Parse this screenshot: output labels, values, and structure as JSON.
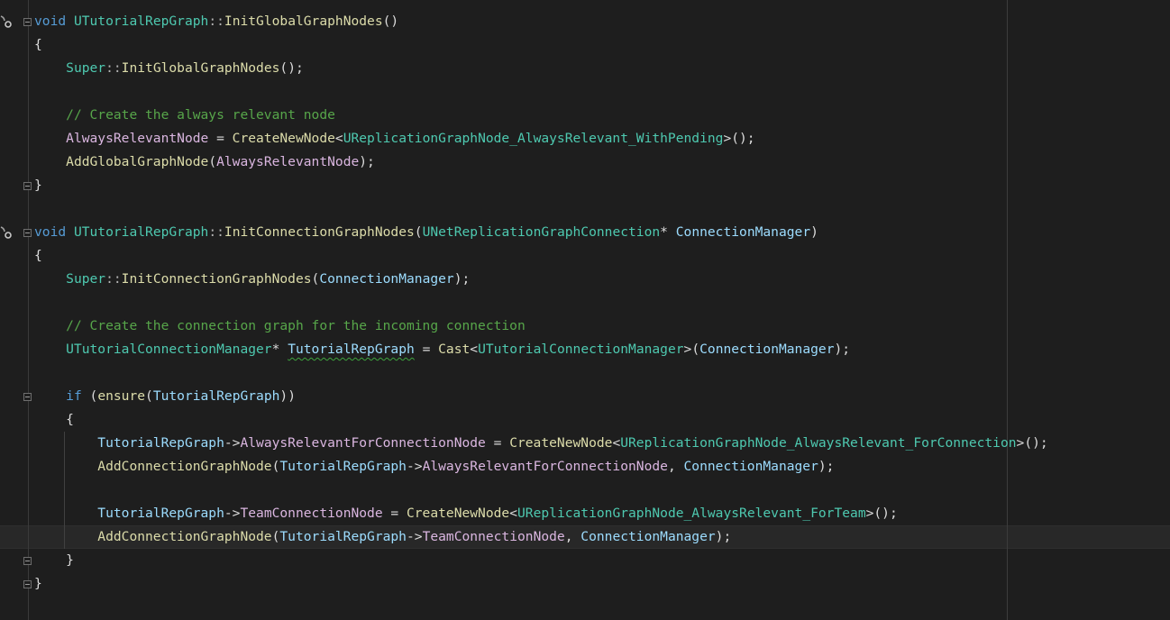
{
  "editor": {
    "lines": [
      {
        "tokens": [
          [
            "void",
            "kw"
          ],
          [
            " ",
            "default"
          ],
          [
            "UTutorialRepGraph",
            "type"
          ],
          [
            "::",
            "punct"
          ],
          [
            "InitGlobalGraphNodes",
            "fn"
          ],
          [
            "()",
            "default"
          ]
        ],
        "fold": true,
        "marker": true
      },
      {
        "tokens": [
          [
            "{",
            "default"
          ]
        ]
      },
      {
        "tokens": [
          [
            "    ",
            "default"
          ],
          [
            "Super",
            "type"
          ],
          [
            "::",
            "punct"
          ],
          [
            "InitGlobalGraphNodes",
            "fn"
          ],
          [
            "();",
            "default"
          ]
        ]
      },
      {
        "tokens": []
      },
      {
        "tokens": [
          [
            "    ",
            "default"
          ],
          [
            "// Create the always relevant node",
            "comment"
          ]
        ]
      },
      {
        "tokens": [
          [
            "    ",
            "default"
          ],
          [
            "AlwaysRelevantNode",
            "member"
          ],
          [
            " = ",
            "default"
          ],
          [
            "CreateNewNode",
            "fn"
          ],
          [
            "<",
            "default"
          ],
          [
            "UReplicationGraphNode_AlwaysRelevant_WithPending",
            "type"
          ],
          [
            ">();",
            "default"
          ]
        ]
      },
      {
        "tokens": [
          [
            "    ",
            "default"
          ],
          [
            "AddGlobalGraphNode",
            "fn"
          ],
          [
            "(",
            "default"
          ],
          [
            "AlwaysRelevantNode",
            "member"
          ],
          [
            ");",
            "default"
          ]
        ]
      },
      {
        "tokens": [
          [
            "}",
            "default"
          ]
        ],
        "fold": true
      },
      {
        "tokens": []
      },
      {
        "tokens": [
          [
            "void",
            "kw"
          ],
          [
            " ",
            "default"
          ],
          [
            "UTutorialRepGraph",
            "type"
          ],
          [
            "::",
            "punct"
          ],
          [
            "InitConnectionGraphNodes",
            "fn"
          ],
          [
            "(",
            "default"
          ],
          [
            "UNetReplicationGraphConnection",
            "type"
          ],
          [
            "* ",
            "default"
          ],
          [
            "ConnectionManager",
            "param"
          ],
          [
            ")",
            "default"
          ]
        ],
        "fold": true,
        "marker": true
      },
      {
        "tokens": [
          [
            "{",
            "default"
          ]
        ]
      },
      {
        "tokens": [
          [
            "    ",
            "default"
          ],
          [
            "Super",
            "type"
          ],
          [
            "::",
            "punct"
          ],
          [
            "InitConnectionGraphNodes",
            "fn"
          ],
          [
            "(",
            "default"
          ],
          [
            "ConnectionManager",
            "param"
          ],
          [
            ");",
            "default"
          ]
        ]
      },
      {
        "tokens": []
      },
      {
        "tokens": [
          [
            "    ",
            "default"
          ],
          [
            "// Create the connection graph for the incoming connection",
            "comment"
          ]
        ]
      },
      {
        "tokens": [
          [
            "    ",
            "default"
          ],
          [
            "UTutorialConnectionManager",
            "type"
          ],
          [
            "* ",
            "default"
          ],
          [
            "TutorialRepGraph",
            "local",
            "squiggle"
          ],
          [
            " = ",
            "default"
          ],
          [
            "Cast",
            "fn"
          ],
          [
            "<",
            "default"
          ],
          [
            "UTutorialConnectionManager",
            "type"
          ],
          [
            ">(",
            "default"
          ],
          [
            "ConnectionManager",
            "param"
          ],
          [
            ");",
            "default"
          ]
        ]
      },
      {
        "tokens": []
      },
      {
        "tokens": [
          [
            "    ",
            "default"
          ],
          [
            "if",
            "kw"
          ],
          [
            " (",
            "default"
          ],
          [
            "ensure",
            "fn"
          ],
          [
            "(",
            "default"
          ],
          [
            "TutorialRepGraph",
            "local"
          ],
          [
            "))",
            "default"
          ]
        ],
        "fold": true
      },
      {
        "tokens": [
          [
            "    {",
            "default"
          ]
        ]
      },
      {
        "tokens": [
          [
            "        ",
            "default"
          ],
          [
            "TutorialRepGraph",
            "local"
          ],
          [
            "->",
            "default"
          ],
          [
            "AlwaysRelevantForConnectionNode",
            "member"
          ],
          [
            " = ",
            "default"
          ],
          [
            "CreateNewNode",
            "fn"
          ],
          [
            "<",
            "default"
          ],
          [
            "UReplicationGraphNode_AlwaysRelevant_ForConnection",
            "type"
          ],
          [
            ">();",
            "default"
          ]
        ]
      },
      {
        "tokens": [
          [
            "        ",
            "default"
          ],
          [
            "AddConnectionGraphNode",
            "fn"
          ],
          [
            "(",
            "default"
          ],
          [
            "TutorialRepGraph",
            "local"
          ],
          [
            "->",
            "default"
          ],
          [
            "AlwaysRelevantForConnectionNode",
            "member"
          ],
          [
            ", ",
            "default"
          ],
          [
            "ConnectionManager",
            "param"
          ],
          [
            ");",
            "default"
          ]
        ]
      },
      {
        "tokens": []
      },
      {
        "tokens": [
          [
            "        ",
            "default"
          ],
          [
            "TutorialRepGraph",
            "local"
          ],
          [
            "->",
            "default"
          ],
          [
            "TeamConnectionNode",
            "member"
          ],
          [
            " = ",
            "default"
          ],
          [
            "CreateNewNode",
            "fn"
          ],
          [
            "<",
            "default"
          ],
          [
            "UReplicationGraphNode_AlwaysRelevant_ForTeam",
            "type"
          ],
          [
            ">();",
            "default"
          ]
        ]
      },
      {
        "tokens": [
          [
            "        ",
            "default"
          ],
          [
            "AddConnectionGraphNode",
            "fn"
          ],
          [
            "(",
            "default"
          ],
          [
            "TutorialRepGraph",
            "local"
          ],
          [
            "->",
            "default"
          ],
          [
            "TeamConnectionNode",
            "member"
          ],
          [
            ", ",
            "default"
          ],
          [
            "ConnectionManager",
            "param"
          ],
          [
            ");",
            "default"
          ]
        ],
        "current": true
      },
      {
        "tokens": [
          [
            "    }",
            "default"
          ]
        ],
        "fold": true
      },
      {
        "tokens": [
          [
            "}",
            "default"
          ]
        ],
        "fold": true
      }
    ]
  },
  "icons": {
    "fold": "fold-toggle-icon",
    "marker": "reference-marker-icon"
  },
  "colors": {
    "background": "#1e1e1e",
    "keyword": "#569cd6",
    "type": "#4ec9b0",
    "function": "#dcdcaa",
    "member": "#dab6e0",
    "parameter": "#9cdcfe",
    "comment": "#57a64a"
  }
}
